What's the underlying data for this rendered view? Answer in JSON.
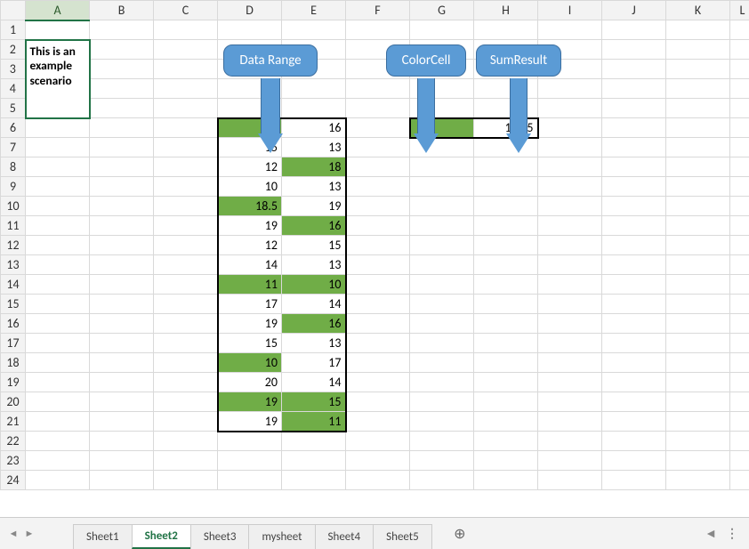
{
  "columns": [
    "",
    "A",
    "B",
    "C",
    "D",
    "E",
    "F",
    "G",
    "H",
    "I",
    "J",
    "K",
    "L"
  ],
  "note_cell": "This is an example scenario",
  "callouts": {
    "data_range": "Data Range",
    "color_cell": "ColorCell",
    "sum_result": "SumResult"
  },
  "color_cell_value": "",
  "sum_result_value": "150.5",
  "data_range": [
    {
      "d": "17",
      "dg": true,
      "e": "16",
      "eg": false
    },
    {
      "d": "15",
      "dg": false,
      "e": "13",
      "eg": false
    },
    {
      "d": "12",
      "dg": false,
      "e": "18",
      "eg": true
    },
    {
      "d": "10",
      "dg": false,
      "e": "13",
      "eg": false
    },
    {
      "d": "18.5",
      "dg": true,
      "e": "19",
      "eg": false
    },
    {
      "d": "19",
      "dg": false,
      "e": "16",
      "eg": true
    },
    {
      "d": "12",
      "dg": false,
      "e": "15",
      "eg": false
    },
    {
      "d": "14",
      "dg": false,
      "e": "13",
      "eg": false
    },
    {
      "d": "11",
      "dg": true,
      "e": "10",
      "eg": true
    },
    {
      "d": "17",
      "dg": false,
      "e": "14",
      "eg": false
    },
    {
      "d": "19",
      "dg": false,
      "e": "16",
      "eg": true
    },
    {
      "d": "15",
      "dg": false,
      "e": "13",
      "eg": false
    },
    {
      "d": "10",
      "dg": true,
      "e": "17",
      "eg": false
    },
    {
      "d": "20",
      "dg": false,
      "e": "14",
      "eg": false
    },
    {
      "d": "19",
      "dg": true,
      "e": "15",
      "eg": true
    },
    {
      "d": "19",
      "dg": false,
      "e": "11",
      "eg": true
    }
  ],
  "sheet_tabs": [
    "Sheet1",
    "Sheet2",
    "Sheet3",
    "mysheet",
    "Sheet4",
    "Sheet5"
  ],
  "active_tab": "Sheet2",
  "colors": {
    "green_fill": "#70ad47",
    "callout_blue": "#5b9bd5",
    "excel_green": "#217346"
  }
}
